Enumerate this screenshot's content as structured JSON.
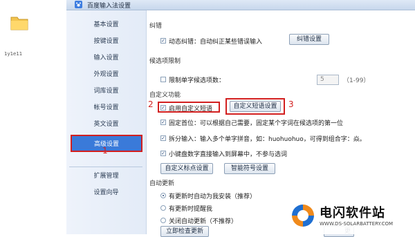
{
  "desktop": {
    "folder_label": "1y1e11"
  },
  "window": {
    "title": "百度输入法设置"
  },
  "sidebar": {
    "items": [
      {
        "label": "基本设置"
      },
      {
        "label": "按键设置"
      },
      {
        "label": "输入设置"
      },
      {
        "label": "外观设置"
      },
      {
        "label": "词库设置"
      },
      {
        "label": "帐号设置"
      },
      {
        "label": "英文设置"
      },
      {
        "label": "高级设置",
        "active": true
      },
      {
        "label": "扩展管理"
      },
      {
        "label": "设置向导"
      }
    ]
  },
  "content": {
    "correction": {
      "heading": "纠错",
      "dynamic_label": "动态纠错：自动纠正某些错误输入",
      "dynamic_checked": true,
      "settings_button": "纠错设置"
    },
    "candidate_limit": {
      "heading": "候选项限制",
      "limit_label": "限制单字候选项数：",
      "limit_checked": false,
      "value": "5",
      "range": "（1-99）"
    },
    "custom": {
      "heading": "自定义功能",
      "enable_phrase_label": "启用自定义短语",
      "enable_phrase_checked": true,
      "phrase_settings_button": "自定义短语设置",
      "fixed_first_label": "固定首位：可以根据自己需要，固定某个字词在候选项的第一位",
      "fixed_first_checked": true,
      "split_label": "拆分输入：输入多个单字拼音，如：huohuohuo，可得到组合字：焱。",
      "split_checked": true,
      "numpad_label": "小键盘数字直接输入到屏幕中，不参与选词",
      "numpad_checked": true,
      "punct_button": "自定义标点设置",
      "smart_symbol_button": "智能符号设置"
    },
    "auto_update": {
      "heading": "自动更新",
      "options": [
        {
          "label": "有更新时自动为我安装（推荐）",
          "selected": true
        },
        {
          "label": "有更新时提醒我",
          "selected": false
        },
        {
          "label": "关闭自动更新（不推荐）",
          "selected": false
        }
      ],
      "check_now_button": "立即检查更新",
      "partial_button": "更"
    }
  },
  "annotations": {
    "one": "1",
    "two": "2",
    "three": "3"
  },
  "watermark": {
    "title": "电闪软件站",
    "url": "WWW.DS-SOLARBATTERY.COM"
  }
}
